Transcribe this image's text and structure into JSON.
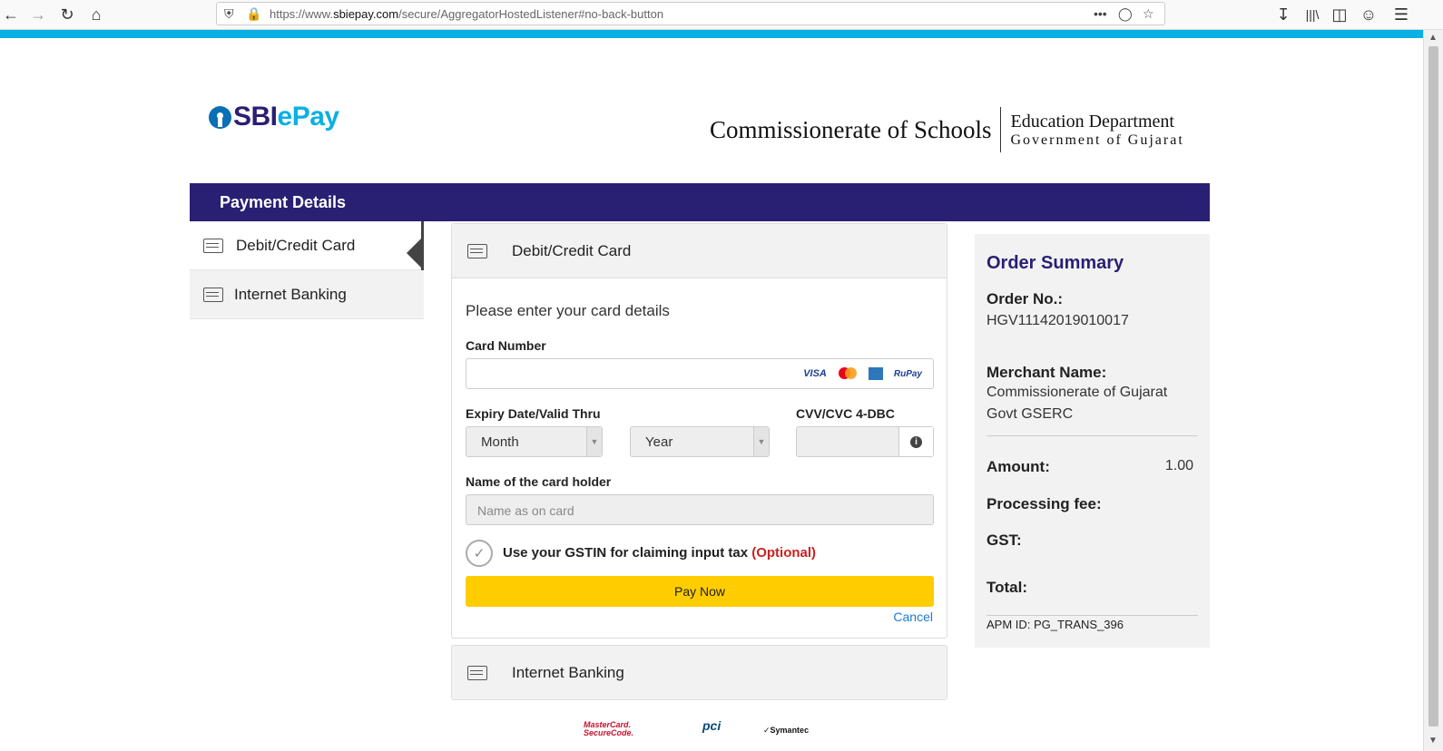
{
  "browser": {
    "url_prefix": "https://www.",
    "url_domain": "sbiepay.com",
    "url_path": "/secure/AggregatorHostedListener#no-back-button"
  },
  "header": {
    "logo_sbi": "SBI",
    "logo_epay": "ePay",
    "dept_main": "Commissionerate of Schools",
    "dept_line1": "Education Department",
    "dept_line2": "Government of Gujarat"
  },
  "banner": {
    "title": "Payment Details"
  },
  "tabs": [
    {
      "label": "Debit/Credit Card",
      "active": true
    },
    {
      "label": "Internet Banking",
      "active": false
    }
  ],
  "card_form": {
    "header": "Debit/Credit Card",
    "instruction": "Please enter your card details",
    "card_number_label": "Card Number",
    "brands": [
      "VISA",
      "MasterCard",
      "Amex",
      "RuPay"
    ],
    "brand_visa": "VISA",
    "brand_rupay": "RuPay",
    "expiry_label": "Expiry Date/Valid Thru",
    "month_value": "Month",
    "year_value": "Year",
    "cvv_label": "CVV/CVC 4-DBC",
    "name_label": "Name of the card holder",
    "name_placeholder": "Name as on card",
    "gst_text": "Use your GSTIN for claiming input tax",
    "gst_optional": "(Optional)",
    "pay_button": "Pay Now",
    "cancel_link": "Cancel"
  },
  "internet_banking_panel": {
    "header": "Internet Banking"
  },
  "order_summary": {
    "title": "Order Summary",
    "order_no_label": "Order No.:",
    "order_no": "HGV11142019010017",
    "merchant_label": "Merchant Name:",
    "merchant_line1": "Commissionerate of Gujarat",
    "merchant_line2": "Govt GSERC",
    "amount_label": "Amount:",
    "amount_value": "1.00",
    "processing_fee_label": "Processing fee:",
    "gst_label": "GST:",
    "total_label": "Total:",
    "apm_id": "APM ID: PG_TRANS_396"
  },
  "footer": {
    "mc_line1": "MasterCard.",
    "mc_line2": "SecureCode.",
    "pci": "pci",
    "symantec": "Symantec"
  },
  "colors": {
    "brand_navy": "#291f73",
    "brand_cyan": "#0ab0e4",
    "pay_button": "#ffcc00",
    "optional_red": "#cc1f1f",
    "link_blue": "#1e7bd2"
  }
}
